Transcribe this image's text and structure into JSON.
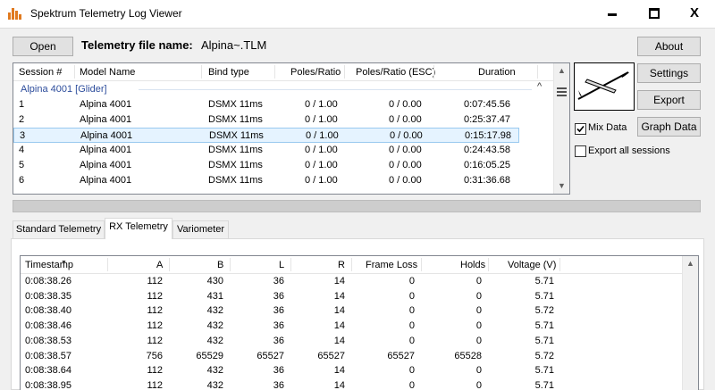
{
  "window": {
    "title": "Spektrum Telemetry Log Viewer",
    "min_label": "—",
    "close_label": "X"
  },
  "toolbar": {
    "open_label": "Open",
    "file_label": "Telemetry file name:",
    "file_name": "Alpina~.TLM"
  },
  "right_panel": {
    "about_label": "About",
    "settings_label": "Settings",
    "export_label": "Export",
    "graph_label": "Graph Data",
    "mix_data_label": "Mix Data",
    "mix_data_checked": true,
    "export_all_label": "Export all sessions",
    "export_all_checked": false,
    "thumbnail_icon": "glider-icon"
  },
  "sessions": {
    "columns": [
      "Session #",
      "Model Name",
      "Bind type",
      "Poles/Ratio",
      "Poles/Ratio (ESC)",
      "Duration"
    ],
    "group": "Alpina 4001 [Glider]",
    "rows": [
      [
        "1",
        "Alpina 4001",
        "DSMX 11ms",
        "0 / 1.00",
        "0 / 0.00",
        "0:07:45.56"
      ],
      [
        "2",
        "Alpina 4001",
        "DSMX 11ms",
        "0 / 1.00",
        "0 / 0.00",
        "0:25:37.47"
      ],
      [
        "3",
        "Alpina 4001",
        "DSMX 11ms",
        "0 / 1.00",
        "0 / 0.00",
        "0:15:17.98"
      ],
      [
        "4",
        "Alpina 4001",
        "DSMX 11ms",
        "0 / 1.00",
        "0 / 0.00",
        "0:24:43.58"
      ],
      [
        "5",
        "Alpina 4001",
        "DSMX 11ms",
        "0 / 1.00",
        "0 / 0.00",
        "0:16:05.25"
      ],
      [
        "6",
        "Alpina 4001",
        "DSMX 11ms",
        "0 / 1.00",
        "0 / 0.00",
        "0:31:36.68"
      ]
    ],
    "selected_index": 2
  },
  "progress_fraction": 0,
  "tabs": [
    "Standard Telemetry",
    "RX Telemetry",
    "Variometer"
  ],
  "active_tab": 1,
  "rx": {
    "columns": [
      "Timestamp",
      "A",
      "B",
      "L",
      "R",
      "Frame Loss",
      "Holds",
      "Voltage (V)"
    ],
    "rows": [
      [
        "0:08:38.26",
        "112",
        "430",
        "36",
        "14",
        "0",
        "0",
        "5.71"
      ],
      [
        "0:08:38.35",
        "112",
        "431",
        "36",
        "14",
        "0",
        "0",
        "5.71"
      ],
      [
        "0:08:38.40",
        "112",
        "432",
        "36",
        "14",
        "0",
        "0",
        "5.72"
      ],
      [
        "0:08:38.46",
        "112",
        "432",
        "36",
        "14",
        "0",
        "0",
        "5.71"
      ],
      [
        "0:08:38.53",
        "112",
        "432",
        "36",
        "14",
        "0",
        "0",
        "5.71"
      ],
      [
        "0:08:38.57",
        "756",
        "65529",
        "65527",
        "65527",
        "65527",
        "65528",
        "5.72"
      ],
      [
        "0:08:38.64",
        "112",
        "432",
        "36",
        "14",
        "0",
        "0",
        "5.71"
      ],
      [
        "0:08:38.95",
        "112",
        "432",
        "36",
        "14",
        "0",
        "0",
        "5.71"
      ]
    ]
  }
}
